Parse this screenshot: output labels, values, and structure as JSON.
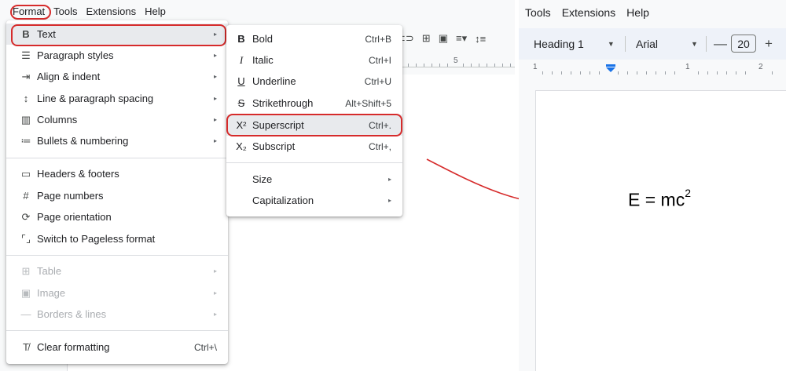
{
  "left": {
    "menubar": [
      "Format",
      "Tools",
      "Extensions",
      "Help"
    ],
    "edge_char": "1",
    "ruler_number": "5",
    "format_menu": {
      "items": [
        {
          "icon": "bold-icon",
          "glyph": "B",
          "label": "Text",
          "arrow": "▸"
        },
        {
          "icon": "paragraph-styles-icon",
          "glyph": "☰",
          "label": "Paragraph styles",
          "arrow": "▸"
        },
        {
          "icon": "align-indent-icon",
          "glyph": "⇥",
          "label": "Align & indent",
          "arrow": "▸"
        },
        {
          "icon": "line-spacing-icon",
          "glyph": "↕",
          "label": "Line & paragraph spacing",
          "arrow": "▸"
        },
        {
          "icon": "columns-icon",
          "glyph": "▥",
          "label": "Columns",
          "arrow": "▸"
        },
        {
          "icon": "bulleted-list-icon",
          "glyph": "≔",
          "label": "Bullets & numbering",
          "arrow": "▸"
        },
        {
          "icon": "header-footer-icon",
          "glyph": "▭",
          "label": "Headers & footers"
        },
        {
          "icon": "hash-icon",
          "glyph": "#",
          "label": "Page numbers"
        },
        {
          "icon": "page-orientation-icon",
          "glyph": "⟳",
          "label": "Page orientation"
        },
        {
          "icon": "pageless-icon",
          "glyph": "⌜⌟",
          "label": "Switch to Pageless format"
        },
        {
          "icon": "table-icon",
          "glyph": "⊞",
          "label": "Table",
          "arrow": "▸",
          "disabled": true
        },
        {
          "icon": "image-icon",
          "glyph": "▣",
          "label": "Image",
          "arrow": "▸",
          "disabled": true
        },
        {
          "icon": "borders-lines-icon",
          "glyph": "—",
          "label": "Borders & lines",
          "arrow": "▸",
          "disabled": true
        },
        {
          "icon": "clear-formatting-icon",
          "glyph": "T̸",
          "label": "Clear formatting",
          "shortcut": "Ctrl+\\"
        }
      ]
    },
    "text_menu": {
      "items": [
        {
          "icon": "bold-icon",
          "glyph": "B",
          "label": "Bold",
          "shortcut": "Ctrl+B"
        },
        {
          "icon": "italic-icon",
          "glyph": "I",
          "label": "Italic",
          "shortcut": "Ctrl+I"
        },
        {
          "icon": "underline-icon",
          "glyph": "U",
          "label": "Underline",
          "shortcut": "Ctrl+U"
        },
        {
          "icon": "strikethrough-icon",
          "glyph": "S",
          "label": "Strikethrough",
          "shortcut": "Alt+Shift+5"
        },
        {
          "icon": "superscript-icon",
          "glyph": "X²",
          "label": "Superscript",
          "shortcut": "Ctrl+."
        },
        {
          "icon": "subscript-icon",
          "glyph": "X₂",
          "label": "Subscript",
          "shortcut": "Ctrl+,"
        },
        {
          "label": "Size",
          "arrow": "▸"
        },
        {
          "label": "Capitalization",
          "arrow": "▸"
        }
      ]
    }
  },
  "right": {
    "menubar": [
      "Tools",
      "Extensions",
      "Help"
    ],
    "style_value": "Heading 1",
    "font_value": "Arial",
    "font_size": "20",
    "minus": "—",
    "plus": "+",
    "ruler_numbers": [
      "1",
      "1",
      "2"
    ],
    "equation_base": "E = mc",
    "equation_exp": "2"
  },
  "colors": {
    "highlight": "#d62b2b",
    "arrow": "#d62b2b",
    "tab_marker": "#1a73e8"
  }
}
